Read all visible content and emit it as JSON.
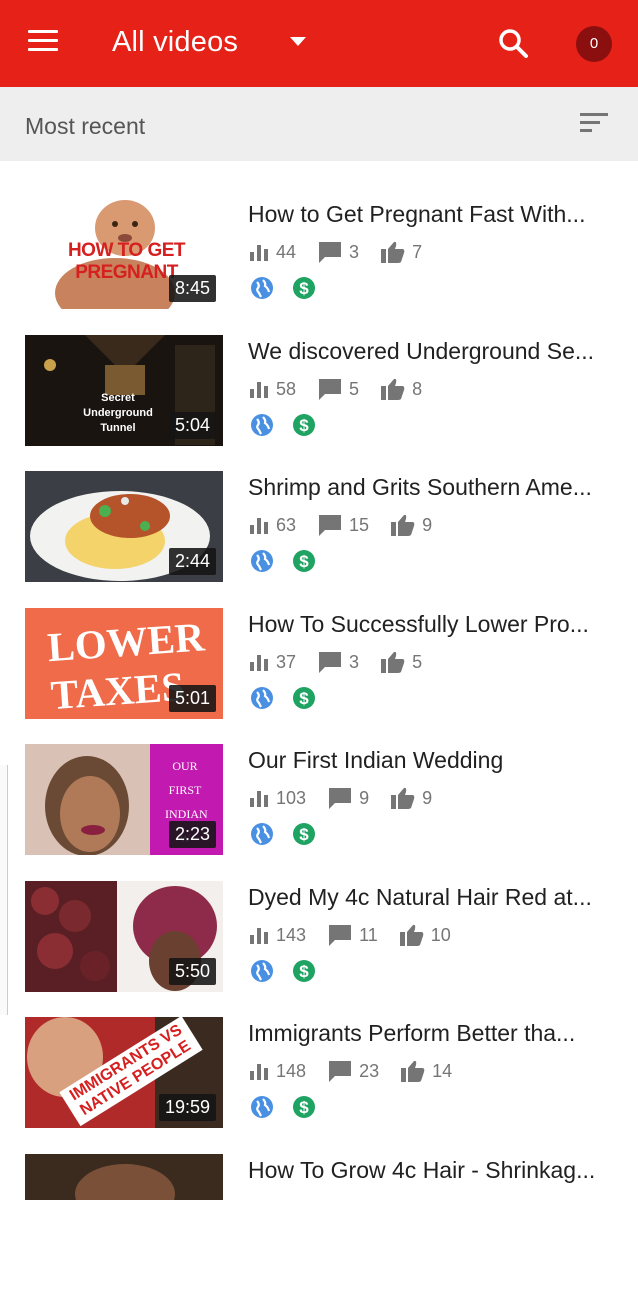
{
  "appbar": {
    "title": "All videos",
    "notification_count": "0",
    "color": "#e62117"
  },
  "subbar": {
    "sort_label": "Most recent"
  },
  "icons": {
    "menu": "hamburger-menu-icon",
    "dropdown": "triangle-down-icon",
    "search": "search-icon",
    "sort": "sort-lines-icon",
    "views": "bar-chart-icon",
    "comments": "comment-bubble-icon",
    "likes": "thumbs-up-icon",
    "visibility": "globe-icon",
    "monetization": "dollar-icon"
  },
  "videos": [
    {
      "title": "How to Get Pregnant Fast With...",
      "duration": "8:45",
      "views": "44",
      "comments": "3",
      "likes": "7",
      "thumb_text": "HOW TO GET PREGNANT"
    },
    {
      "title": "We discovered Underground Se...",
      "duration": "5:04",
      "views": "58",
      "comments": "5",
      "likes": "8",
      "thumb_text": "Secret Underground Tunnel"
    },
    {
      "title": "Shrimp and Grits Southern Ame...",
      "duration": "2:44",
      "views": "63",
      "comments": "15",
      "likes": "9",
      "thumb_text": ""
    },
    {
      "title": "How To Successfully Lower Pro...",
      "duration": "5:01",
      "views": "37",
      "comments": "3",
      "likes": "5",
      "thumb_text": "LOWER TAXES"
    },
    {
      "title": "Our First Indian Wedding",
      "duration": "2:23",
      "views": "103",
      "comments": "9",
      "likes": "9",
      "thumb_text": "OUR FIRST INDIAN W"
    },
    {
      "title": "Dyed My 4c Natural Hair Red at...",
      "duration": "5:50",
      "views": "143",
      "comments": "11",
      "likes": "10",
      "thumb_text": ""
    },
    {
      "title": "Immigrants Perform Better tha...",
      "duration": "19:59",
      "views": "148",
      "comments": "23",
      "likes": "14",
      "thumb_text": "IMMIGRANTS VS NATIVE PEOPLE"
    },
    {
      "title": "How To Grow 4c Hair - Shrinkag...",
      "duration": "",
      "views": "",
      "comments": "",
      "likes": "",
      "thumb_text": ""
    }
  ]
}
